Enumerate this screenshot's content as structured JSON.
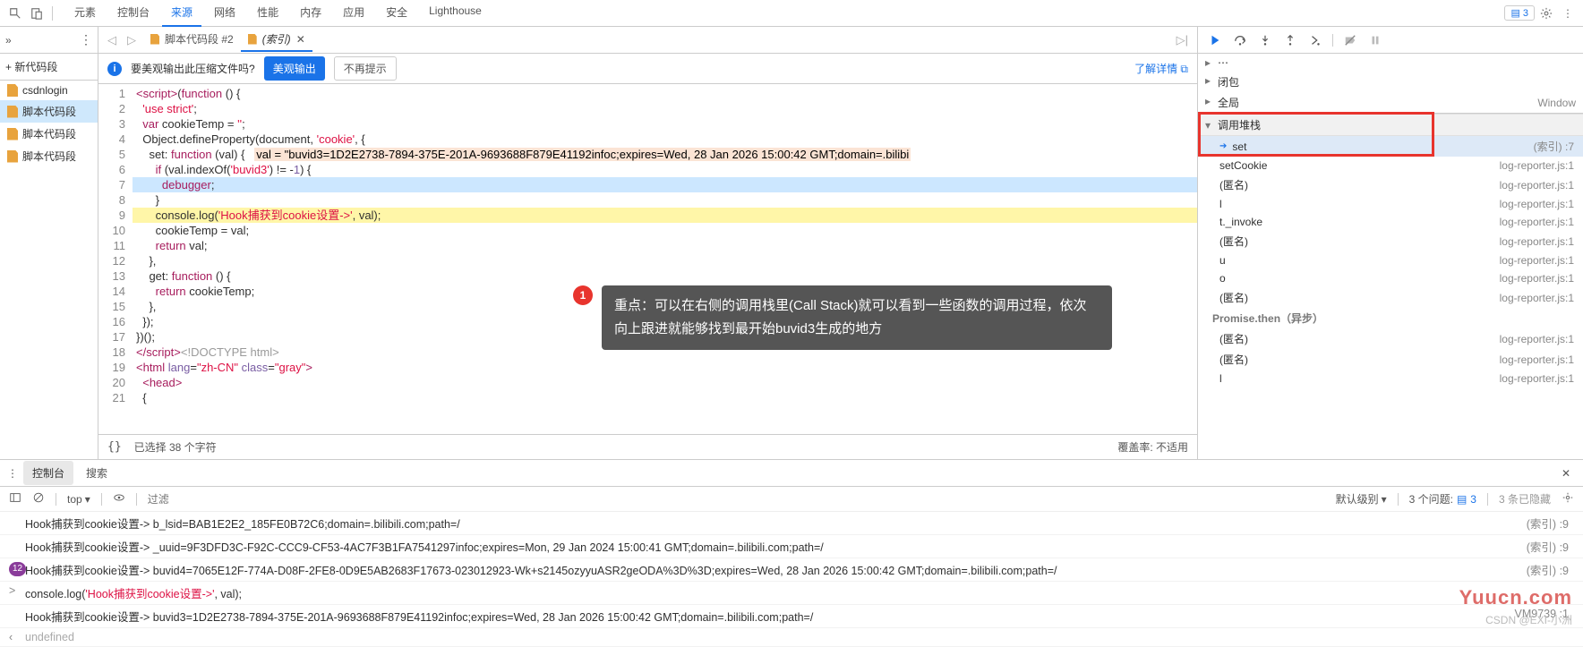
{
  "topbar": {
    "tabs": [
      "元素",
      "控制台",
      "来源",
      "网络",
      "性能",
      "内存",
      "应用",
      "安全",
      "Lighthouse"
    ],
    "active": 2,
    "messages": "3"
  },
  "sidebar": {
    "add_label": "+ 新代码段",
    "items": [
      "csdnlogin",
      "脚本代码段",
      "脚本代码段",
      "脚本代码段"
    ],
    "selected": 1
  },
  "open_tabs": {
    "items": [
      {
        "label": "脚本代码段 #2",
        "active": false,
        "close": false
      },
      {
        "label": "(索引)",
        "active": true,
        "close": true
      }
    ]
  },
  "pretty": {
    "question": "要美观输出此压缩文件吗?",
    "ok": "美观输出",
    "no": "不再提示",
    "learn": "了解详情"
  },
  "code": {
    "lines": [
      {
        "n": 1,
        "html": "<span class='tag'>&lt;script&gt;</span>(<span class='kw'>function</span> () {"
      },
      {
        "n": 2,
        "html": "  <span class='str'>'use strict'</span>;"
      },
      {
        "n": 3,
        "html": "  <span class='kw'>var</span> cookieTemp = <span class='str'>''</span>;"
      },
      {
        "n": 4,
        "html": "  Object.defineProperty(document, <span class='str'>'cookie'</span>, {"
      },
      {
        "n": 5,
        "html": "    set: <span class='kw'>function</span> (val) {   <span class='inlval'>val = \"buvid3=1D2E2738-7894-375E-201A-9693688F879E41192infoc;expires=Wed, 28 Jan 2026 15:00:42 GMT;domain=.bilibi</span>"
      },
      {
        "n": 6,
        "html": "      <span class='kw'>if</span> (val.indexOf(<span class='str'>'buvid3'</span>) != -<span class='num'>1</span>) {"
      },
      {
        "n": 7,
        "html": "        <span class='kw'>debugger</span>;",
        "cls": "hl-pause"
      },
      {
        "n": 8,
        "html": "      }"
      },
      {
        "n": 9,
        "html": "      console.log(<span class='str'>'Hook捕获到cookie设置-&gt;'</span>, val);",
        "cls": "hl-exec"
      },
      {
        "n": 10,
        "html": "      cookieTemp = val;"
      },
      {
        "n": 11,
        "html": "      <span class='kw'>return</span> val;"
      },
      {
        "n": 12,
        "html": "    },"
      },
      {
        "n": 13,
        "html": "    get: <span class='kw'>function</span> () {"
      },
      {
        "n": 14,
        "html": "      <span class='kw'>return</span> cookieTemp;"
      },
      {
        "n": 15,
        "html": "    },"
      },
      {
        "n": 16,
        "html": "  });"
      },
      {
        "n": 17,
        "html": "})();"
      },
      {
        "n": 18,
        "html": "<span class='tag'>&lt;/script&gt;</span><span class='cm'>&lt;!DOCTYPE html&gt;</span>"
      },
      {
        "n": 19,
        "html": "<span class='tag'>&lt;html</span> <span class='attr'>lang</span>=<span class='str'>\"zh-CN\"</span> <span class='attr'>class</span>=<span class='str'>\"gray\"</span><span class='tag'>&gt;</span>"
      },
      {
        "n": 20,
        "html": "  <span class='tag'>&lt;head&gt;</span>"
      },
      {
        "n": 21,
        "html": "  {"
      }
    ]
  },
  "footer": {
    "selection": "已选择 38 个字符",
    "coverage": "覆盖率: 不适用"
  },
  "tooltip": {
    "n": "1",
    "text": "重点：可以在右侧的调用栈里(Call Stack)就可以看到一些函数的调用过程，依次向上跟进就能够找到最开始buvid3生成的地方"
  },
  "scopes": {
    "items": [
      {
        "label": "闭包",
        "arr": "▸"
      },
      {
        "label": "全局",
        "arr": "▸",
        "right": "Window"
      }
    ],
    "callstack_header": "调用堆栈"
  },
  "callstack": {
    "items": [
      {
        "name": "set",
        "src": "(索引) :7",
        "current": true
      },
      {
        "name": "setCookie",
        "src": "log-reporter.js:1"
      },
      {
        "name": "(匿名)",
        "src": "log-reporter.js:1"
      },
      {
        "name": "l",
        "src": "log-reporter.js:1"
      },
      {
        "name": "t._invoke",
        "src": "log-reporter.js:1"
      },
      {
        "name": "(匿名)",
        "src": "log-reporter.js:1"
      },
      {
        "name": "u",
        "src": "log-reporter.js:1"
      },
      {
        "name": "o",
        "src": "log-reporter.js:1"
      },
      {
        "name": "(匿名)",
        "src": "log-reporter.js:1"
      },
      {
        "name": "Promise.then（异步）",
        "async": true
      },
      {
        "name": "(匿名)",
        "src": "log-reporter.js:1"
      },
      {
        "name": "(匿名)",
        "src": "log-reporter.js:1"
      },
      {
        "name": "l",
        "src": "log-reporter.js:1"
      }
    ]
  },
  "console_tabs": {
    "items": [
      "控制台",
      "搜索"
    ],
    "active": 0
  },
  "console_filter": {
    "top": "top",
    "filter_ph": "过滤",
    "level": "默认级别",
    "problems_count": "3 个问题:",
    "msgs": "3",
    "hidden": "3 条已隐藏"
  },
  "console_lines": [
    {
      "pre": "",
      "body": "Hook捕获到cookie设置-> b_lsid=BAB1E2E2_185FE0B72C6;domain=.bilibili.com;path=/",
      "src": "(索引) :9"
    },
    {
      "pre": "",
      "body": "Hook捕获到cookie设置-> _uuid=9F3DFD3C-F92C-CCC9-CF53-4AC7F3B1FA7541297infoc;expires=Mon, 29 Jan 2024 15:00:41 GMT;domain=.bilibili.com;path=/",
      "src": "(索引) :9"
    },
    {
      "pre": "12",
      "body": "Hook捕获到cookie设置-> buvid4=7065E12F-774A-D08F-2FE8-0D9E5AB2683F17673-023012923-Wk+s2145ozyyuASR2geODA%3D%3D;expires=Wed, 28 Jan 2026 15:00:42 GMT;domain=.bilibili.com;path=/",
      "src": "(索引) :9",
      "badge": true
    },
    {
      "pre": ">",
      "body": "console.log(<span class='cstr'>'Hook捕获到cookie设置-&gt;'</span>, val);",
      "src": ""
    },
    {
      "pre": "",
      "body": "Hook捕获到cookie设置-> buvid3=1D2E2738-7894-375E-201A-9693688F879E41192infoc;expires=Wed, 28 Jan 2026 15:00:42 GMT;domain=.bilibili.com;path=/",
      "src": "VM9739 :1"
    },
    {
      "pre": "‹",
      "body": "undefined",
      "src": "",
      "undef": true
    }
  ],
  "watermark": "Yuucn.com",
  "attrib": "CSDN @EXI-小洲"
}
